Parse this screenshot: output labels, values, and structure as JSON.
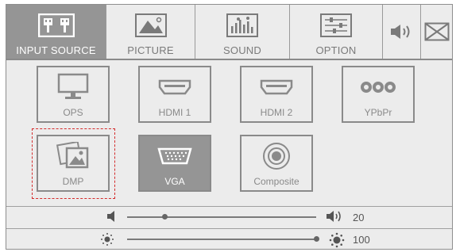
{
  "tabs": [
    {
      "label": "INPUT SOURCE",
      "icon": "input-source-icon",
      "active": true
    },
    {
      "label": "PICTURE",
      "icon": "picture-icon"
    },
    {
      "label": "SOUND",
      "icon": "sound-icon"
    },
    {
      "label": "OPTION",
      "icon": "option-icon"
    }
  ],
  "extra_tabs": {
    "volume_icon": "speaker-icon",
    "close_icon": "close-box-icon"
  },
  "sources": [
    {
      "label": "OPS",
      "icon": "monitor-icon"
    },
    {
      "label": "HDMI 1",
      "icon": "hdmi-icon"
    },
    {
      "label": "HDMI 2",
      "icon": "hdmi-icon"
    },
    {
      "label": "YPbPr",
      "icon": "component-rca-icon"
    },
    {
      "label": "DMP",
      "icon": "media-player-icon",
      "focused": true
    },
    {
      "label": "VGA",
      "icon": "vga-icon",
      "selected": true
    },
    {
      "label": "Composite",
      "icon": "composite-icon"
    }
  ],
  "volume": {
    "value": "20",
    "level": 0.2
  },
  "brightness": {
    "value": "100",
    "level": 1.0
  },
  "colors": {
    "panel": "#ececec",
    "selected": "#959595",
    "border": "#8a8a8a",
    "focus": "#d42b2b"
  }
}
